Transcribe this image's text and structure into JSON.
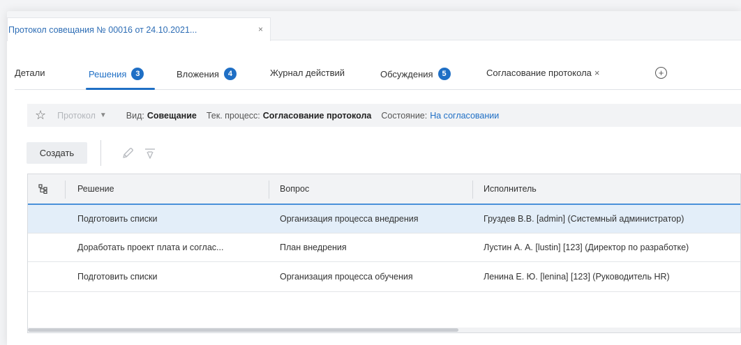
{
  "document_tab": {
    "title": "Протокол совещания № 00016 от 24.10.2021...",
    "close_glyph": "×"
  },
  "tabs": [
    {
      "label": "Детали",
      "badge": ""
    },
    {
      "label": "Решения",
      "badge": "3",
      "active": true
    },
    {
      "label": "Вложения",
      "badge": "4"
    },
    {
      "label": "Журнал действий",
      "badge": ""
    },
    {
      "label": "Обсуждения",
      "badge": "5"
    },
    {
      "label": "Согласование протокола",
      "badge": "",
      "closable": true,
      "close_glyph": "×"
    }
  ],
  "add_tab_glyph": "+",
  "info": {
    "type_label": "Протокол",
    "kind_label": "Вид:",
    "kind_value": "Совещание",
    "process_label": "Тек. процесс:",
    "process_value": "Согласование протокола",
    "state_label": "Состояние:",
    "state_value": "На согласовании"
  },
  "toolbar": {
    "create_label": "Создать",
    "edit_icon": "pencil-icon",
    "delete_icon": "trash-icon"
  },
  "grid": {
    "columns": [
      "Решение",
      "Вопрос",
      "Исполнитель"
    ],
    "rows": [
      {
        "decision": "Подготовить списки",
        "question": "Организация процесса внедрения",
        "assignee": "Груздев В.В. [admin] (Системный администратор)",
        "selected": true
      },
      {
        "decision": "Доработать проект плата и соглас...",
        "question": "План внедрения",
        "assignee": "Лустин А. А. [lustin] [123] (Директор по разработке)"
      },
      {
        "decision": "Подготовить списки",
        "question": "Организация процесса обучения",
        "assignee": "Ленина Е. Ю. [lenina] [123] (Руководитель HR)"
      }
    ]
  },
  "colors": {
    "accent": "#1f6fc5",
    "selected_row": "#e3eef9",
    "header_bg": "#f2f3f5"
  }
}
